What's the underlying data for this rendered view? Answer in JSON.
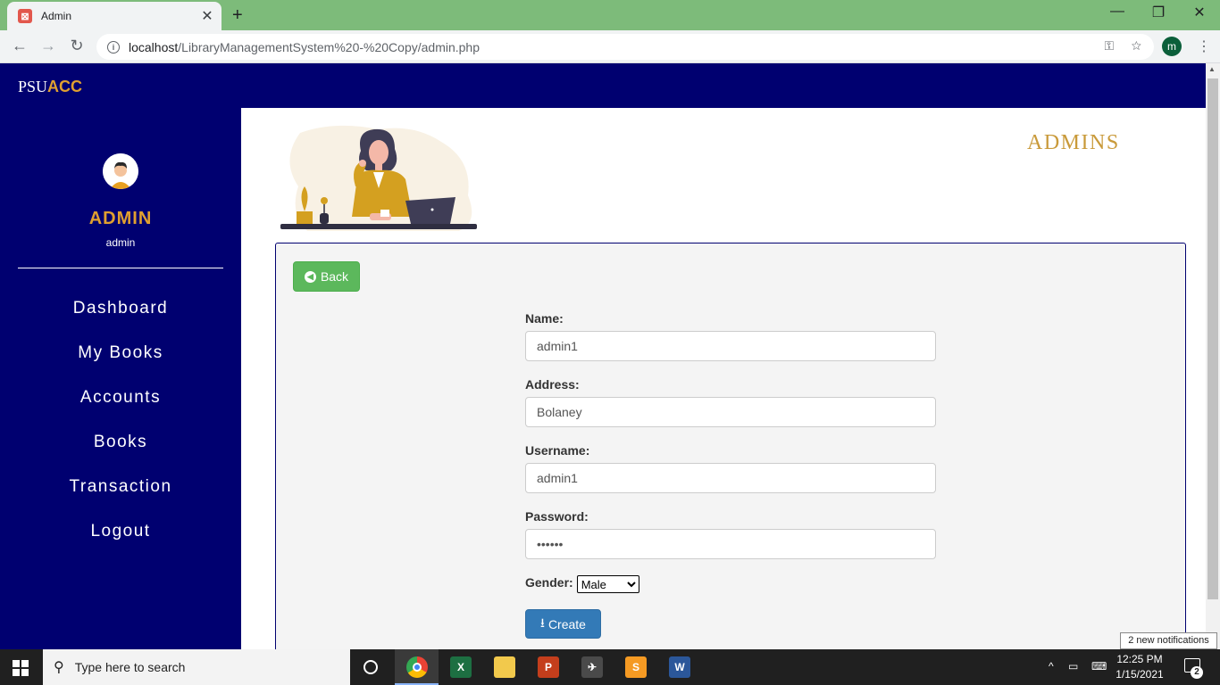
{
  "browser": {
    "tab_title": "Admin",
    "url_host": "localhost",
    "url_path": "/LibraryManagementSystem%20-%20Copy/admin.php",
    "profile_initial": "m"
  },
  "brand": {
    "prefix": "PSU",
    "suffix": "ACC"
  },
  "sidebar": {
    "role": "ADMIN",
    "username": "admin",
    "items": [
      {
        "label": "Dashboard"
      },
      {
        "label": "My Books"
      },
      {
        "label": "Accounts"
      },
      {
        "label": "Books"
      },
      {
        "label": "Transaction"
      },
      {
        "label": "Logout"
      }
    ]
  },
  "main": {
    "heading": "ADMINS",
    "back_label": "Back",
    "form": {
      "name_label": "Name:",
      "name_value": "admin1",
      "address_label": "Address:",
      "address_value": "Bolaney",
      "username_label": "Username:",
      "username_value": "admin1",
      "password_label": "Password:",
      "password_value": "••••••",
      "gender_label": "Gender:",
      "gender_selected": "Male",
      "create_label": "Create"
    }
  },
  "notification": "2 new notifications",
  "taskbar": {
    "search_placeholder": "Type here to search",
    "time": "12:25 PM",
    "date": "1/15/2021",
    "action_badge": "2"
  },
  "colors": {
    "navy": "#000070",
    "gold": "#e0a030",
    "heading_gold": "#c99a3a",
    "success": "#5cb85c",
    "primary": "#337ab7"
  }
}
